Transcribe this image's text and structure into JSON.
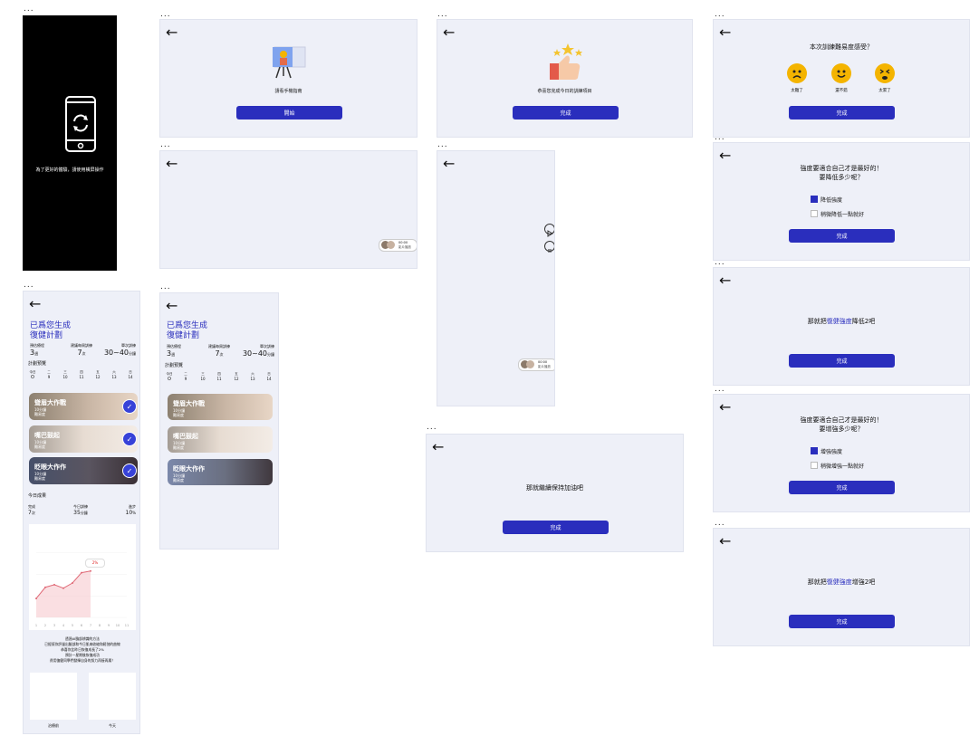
{
  "frame_marker": "...",
  "rotate": {
    "text": "為了更好的體驗，請使用橫屏操作"
  },
  "start_screen": {
    "caption": "請看手機指南",
    "button": "開始"
  },
  "praise_screen": {
    "caption": "恭喜您完成今日的訓練項目",
    "button": "完成"
  },
  "rating_screen": {
    "question": "本次訓練難易度感受？",
    "options": [
      "太難了",
      "還不錯",
      "太累了"
    ],
    "button": "完成"
  },
  "decrease_screen": {
    "title_line1": "強度要適合自己才是最好的！",
    "title_line2": "要降低多少呢？",
    "option_checked": "降低強度",
    "option_unchecked": "稍微降低一點就好",
    "button": "完成"
  },
  "decrease_confirm": {
    "prefix": "那就把",
    "highlight": "復健強度",
    "suffix": "降低2吧",
    "button": "完成"
  },
  "increase_screen": {
    "title_line1": "強度要適合自己才是最好的！",
    "title_line2": "要增強多少呢？",
    "option_checked": "增強強度",
    "option_unchecked": "稍微增強一點就好",
    "button": "完成"
  },
  "increase_confirm": {
    "prefix": "那就把",
    "highlight": "復健強度",
    "suffix": "增強2吧",
    "button": "完成"
  },
  "keep_screen": {
    "message": "那就繼續保持加油吧",
    "button": "完成"
  },
  "video_badge": {
    "line1": "00:00",
    "line2": "影片播放"
  },
  "plan": {
    "title_line1": "已爲您生成",
    "title_line2": "復健計劃",
    "stats": [
      {
        "label": "預估療程",
        "value": "3",
        "unit": "週"
      },
      {
        "label": "建議每周訓練",
        "value": "7",
        "unit": "次"
      },
      {
        "label": "單次訓練",
        "value": "30~40",
        "unit": "分鐘"
      }
    ],
    "schedule_label": "計劃預覽",
    "days": [
      {
        "name": "今日",
        "date": "O"
      },
      {
        "name": "二",
        "date": "9"
      },
      {
        "name": "三",
        "date": "10"
      },
      {
        "name": "四",
        "date": "11"
      },
      {
        "name": "五",
        "date": "12"
      },
      {
        "name": "六",
        "date": "13"
      },
      {
        "name": "日",
        "date": "14"
      }
    ],
    "cards": [
      {
        "title": "聳眉大作戰",
        "line1": "10分鐘",
        "line2": "難易度",
        "accent": "#8c8070"
      },
      {
        "title": "嘴巴鼓起",
        "line1": "10分鐘",
        "line2": "難易度",
        "accent": "#a49c94"
      },
      {
        "title": "眨眼大作作",
        "line1": "10分鐘",
        "line2": "難易度",
        "accent": "#46506a"
      }
    ],
    "today_label": "今日成果",
    "today_stats": [
      {
        "label": "完成",
        "value": "7",
        "unit": "次"
      },
      {
        "label": "今日訓練",
        "value": "35",
        "unit": "分鐘"
      },
      {
        "label": "進步",
        "value": "10",
        "unit": "%"
      }
    ],
    "chart_note": "2%",
    "summary_lines": [
      "透過AI臉部辨識的方法",
      "已經幫你評量出臉部和今日肌肉收縮和鬆弛的曲線",
      "恭喜你比昨日恢復成長了2%",
      "預計一星期後恢復成功",
      "費用復健同學們發揮自身的努力再接再厲！"
    ],
    "photo_labels": [
      "治療前",
      "今天"
    ]
  },
  "chart_data": {
    "type": "line",
    "x": [
      1,
      2,
      3,
      4,
      5,
      6,
      7,
      8,
      9,
      10,
      11
    ],
    "series": [
      {
        "values": [
          22,
          35,
          38,
          34,
          40,
          52,
          54,
          null,
          null,
          null,
          null
        ]
      }
    ],
    "ylim": [
      0,
      100
    ],
    "grid": true,
    "colors": {
      "line": "#e06b78",
      "fill": "#f6c9cf"
    }
  }
}
